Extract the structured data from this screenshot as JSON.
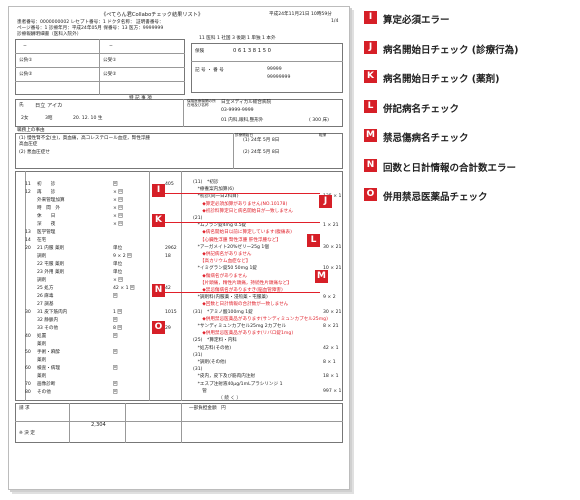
{
  "doc": {
    "title": "《ぺてらん君Collaboチェック結果リスト》",
    "date": "平成24年11月21日 10時59分",
    "page": "1/4",
    "hdr_line1": "患者番号：0000000002  レセプト番号：1  ドクタ名称：             証明書番号：",
    "hdr_line2": "ページ番号：1  診療年月：平成24年05月  保番号：13  医方：9999999",
    "hdr_label": "診療報酬明細書（医科入院外）",
    "hdr_right": "11  医科  1  社国  3  後期  1  単独  1  本外",
    "kou1": "公負①",
    "kou2": "公受①",
    "kou3": "公負②",
    "kou4": "公受②",
    "hoken_label": "保険",
    "hoken_no": "0 6 1 3 8 1 5 0",
    "kigo_label": "記 号 ・ 番 号",
    "kigo_val1": "99999",
    "kigo_val2": "99999999",
    "shimei_label": "氏",
    "patient": "日立 アイカ",
    "tokki": "特 記 事 項",
    "sex": "2女",
    "era": "3昭",
    "birth": "20. 12. 10 生",
    "work": "職務上の事由",
    "inst_label": "保険医療機関の所在地及び名称",
    "inst": "日立メディカル総合病院",
    "tel": "03-9999-9999",
    "dept": "01 内科,眼科,整形外",
    "days": "( 300 床)",
    "dx1": "(1) 慢性腎不全(主)，貧血痛，高コレステロール血症，腎性浮腫",
    "dx1b": "    高血圧症",
    "dx2": "(2) 悪血圧症せ",
    "kaishi_label": "診療開始日",
    "kaishi1": "(1)  24年 5月 8日",
    "kaishi2": "(2)  24年 5月 8日",
    "tenki_label": "転帰",
    "left_rows": [
      {
        "code": "11",
        "name": "初　　診",
        "kai": "回",
        "ten": "405"
      },
      {
        "code": "12",
        "name": "再　　診",
        "kai": "×    回",
        "ten": ""
      },
      {
        "code": "",
        "name": "外来管理加算",
        "kai": "×    回",
        "ten": ""
      },
      {
        "code": "",
        "name": "時　間　外",
        "kai": "×    回",
        "ten": ""
      },
      {
        "code": "",
        "name": "休　　日",
        "kai": "×    回",
        "ten": ""
      },
      {
        "code": "",
        "name": "深　　夜",
        "kai": "×    回",
        "ten": ""
      },
      {
        "code": "13",
        "name": "医学管理",
        "kai": "",
        "ten": ""
      },
      {
        "code": "14",
        "name": "在宅",
        "kai": "",
        "ten": ""
      },
      {
        "code": "20",
        "name": "21 内服 薬剤",
        "kai": "単位",
        "ten": "2962"
      },
      {
        "code": "",
        "name": "調剤",
        "kai": "9 × 2 回",
        "ten": "18"
      },
      {
        "code": "",
        "name": "22 屯服 薬剤",
        "kai": "単位",
        "ten": ""
      },
      {
        "code": "",
        "name": "23 外用 薬剤",
        "kai": "単位",
        "ten": ""
      },
      {
        "code": "",
        "name": "調剤",
        "kai": "×    回",
        "ten": ""
      },
      {
        "code": "",
        "name": "25 処方",
        "kai": "42 ×  1 回",
        "ten": "42"
      },
      {
        "code": "",
        "name": "26 麻毒",
        "kai": "回",
        "ten": ""
      },
      {
        "code": "",
        "name": "27 調基",
        "kai": "",
        "ten": ""
      },
      {
        "code": "30",
        "name": "31 皮下筋肉内",
        "kai": "1 回",
        "ten": "1015"
      },
      {
        "code": "",
        "name": "32 静脈内",
        "kai": "回",
        "ten": ""
      },
      {
        "code": "",
        "name": "33 その他",
        "kai": "8 回",
        "ten": "29"
      },
      {
        "code": "40",
        "name": "処置",
        "kai": "回",
        "ten": ""
      },
      {
        "code": "",
        "name": "薬剤",
        "kai": "",
        "ten": ""
      },
      {
        "code": "50",
        "name": "手術・麻酔",
        "kai": "回",
        "ten": ""
      },
      {
        "code": "",
        "name": "薬剤",
        "kai": "",
        "ten": ""
      },
      {
        "code": "60",
        "name": "検査・病理",
        "kai": "回",
        "ten": ""
      },
      {
        "code": "",
        "name": "薬剤",
        "kai": "",
        "ten": ""
      },
      {
        "code": "70",
        "name": "画像診断",
        "kai": "回",
        "ten": ""
      },
      {
        "code": "80",
        "name": "その他",
        "kai": "回",
        "ten": ""
      }
    ],
    "right_lines": [
      {
        "t": "(11)　*初診",
        "c": "n",
        "v": ""
      },
      {
        "t": "　*療養案内加算(6)",
        "c": "n",
        "v": ""
      },
      {
        "t": "　*初診(同一日2科目)",
        "c": "n",
        "v": "135 × 1"
      },
      {
        "t": "　　◆算定必須加算がありません(NO.10178)",
        "c": "r",
        "v": ""
      },
      {
        "t": "　　◆初診料算定日と病名開始日が一致しません",
        "c": "r",
        "v": ""
      },
      {
        "t": "(21)",
        "c": "n",
        "v": ""
      },
      {
        "t": "　*ムプラン錠4mg 0.5錠",
        "c": "n",
        "v": "1 × 21"
      },
      {
        "t": "　　◆病名開始日以前に算定しています(腹痛表)",
        "c": "r",
        "v": ""
      },
      {
        "t": "　　【心臓性浮腫 腎性浮腫 肝性浮腫など】",
        "c": "r",
        "v": ""
      },
      {
        "t": "　*アーガメイト20%ゼリー25g 1個",
        "c": "n",
        "v": "30 × 21"
      },
      {
        "t": "　　◆併記病名がありません",
        "c": "r",
        "v": ""
      },
      {
        "t": "　　【高カリウム血症など】",
        "c": "r",
        "v": ""
      },
      {
        "t": "　*イミグラン錠50 50mg 1錠",
        "c": "n",
        "v": "10 × 21"
      },
      {
        "t": "　　◆傷病名がありません",
        "c": "r",
        "v": ""
      },
      {
        "t": "　　【片頭痛，精性片頭痛，持続性片頭痛など】",
        "c": "r",
        "v": ""
      },
      {
        "t": "　　◆禁忌傷病名がありますき(脳血管障害)",
        "c": "r",
        "v": ""
      },
      {
        "t": "　*調剤料(内服薬・浸煎薬・屯服薬)",
        "c": "n",
        "v": "9 × 2"
      },
      {
        "t": "　　◆回数と日計情報の合計数が一致しません",
        "c": "r",
        "v": ""
      },
      {
        "t": "(31)　*アミノ酸100mg 1錠",
        "c": "n",
        "v": "30 × 21"
      },
      {
        "t": "　　◆併用禁忌医薬品があります(サンディミュンカプセル25mg)",
        "c": "r",
        "v": ""
      },
      {
        "t": "　*サンディミュンカプセル25mg 2カプセル",
        "c": "n",
        "v": "8 × 21"
      },
      {
        "t": "　　◆併用禁忌医薬品があります(リバロ錠1mg)",
        "c": "r",
        "v": ""
      },
      {
        "t": "(25)　*算定料・内科",
        "c": "n",
        "v": ""
      },
      {
        "t": "　*処方料(その他)",
        "c": "n",
        "v": "42 × 1"
      },
      {
        "t": "(31)",
        "c": "n",
        "v": ""
      },
      {
        "t": "　*調剤(その他)",
        "c": "n",
        "v": "8 × 1"
      },
      {
        "t": "(31)",
        "c": "n",
        "v": ""
      },
      {
        "t": "　*皮内，皮下及び筋肉内注射",
        "c": "n",
        "v": "18 × 1"
      },
      {
        "t": "　*エスプ注射液40μg/1mLプラシリンジ 1",
        "c": "n",
        "v": ""
      },
      {
        "t": "　　管",
        "c": "n",
        "v": "997 × 1"
      },
      {
        "t": "　　　　　　（ 続 く ）",
        "c": "n",
        "v": ""
      }
    ],
    "ftr_seikyu": "請 求",
    "ftr_total": "2,304",
    "ftr_ketsu": "※ 決 定",
    "ftr_futan": "一部負担金額　円"
  },
  "legend": [
    {
      "letter": "I",
      "label": "算定必須エラー"
    },
    {
      "letter": "J",
      "label": "病名開始日チェック (診療行為)"
    },
    {
      "letter": "K",
      "label": "病名開始日チェック (薬剤)"
    },
    {
      "letter": "L",
      "label": "併記病名チェック"
    },
    {
      "letter": "M",
      "label": "禁忌傷病名チェック"
    },
    {
      "letter": "N",
      "label": "回数と日計情報の合計数エラー"
    },
    {
      "letter": "O",
      "label": "併用禁忌医薬品チェック"
    }
  ],
  "colors": {
    "marker": "#d61f27",
    "error_text": "#e0202a"
  }
}
